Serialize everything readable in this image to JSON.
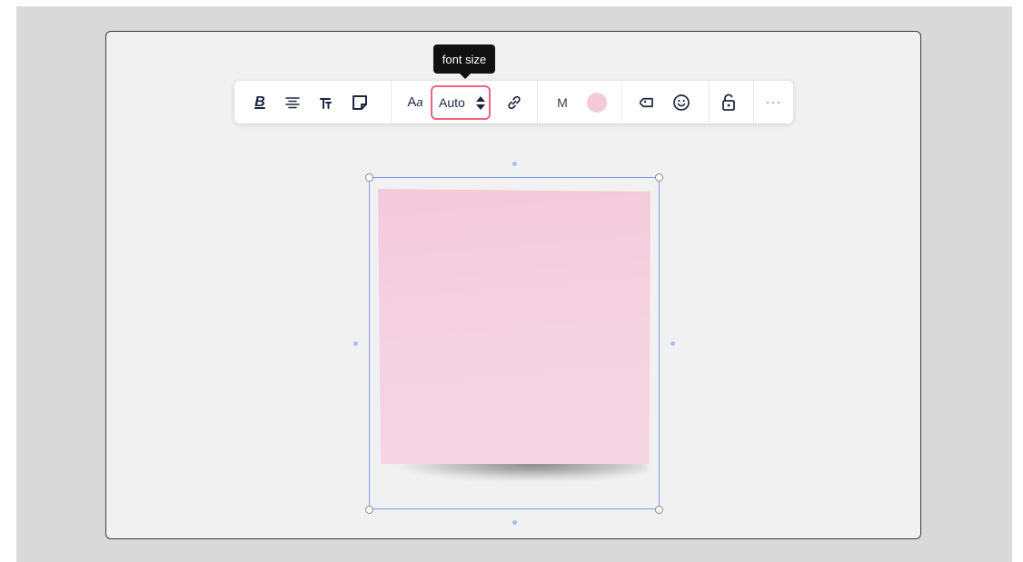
{
  "toolbar": {
    "bold_label": "B",
    "font_size": {
      "tooltip": "font size",
      "value": "Auto"
    },
    "size_label": "M",
    "color": "#f4c9d8"
  },
  "sticky_note": {
    "color": "#f5cfde",
    "text": ""
  },
  "colors": {
    "accent_highlight": "#f0617a",
    "selection": "#7b9cf0",
    "canvas": "#f1f1f1",
    "icon": "#1f2540"
  }
}
